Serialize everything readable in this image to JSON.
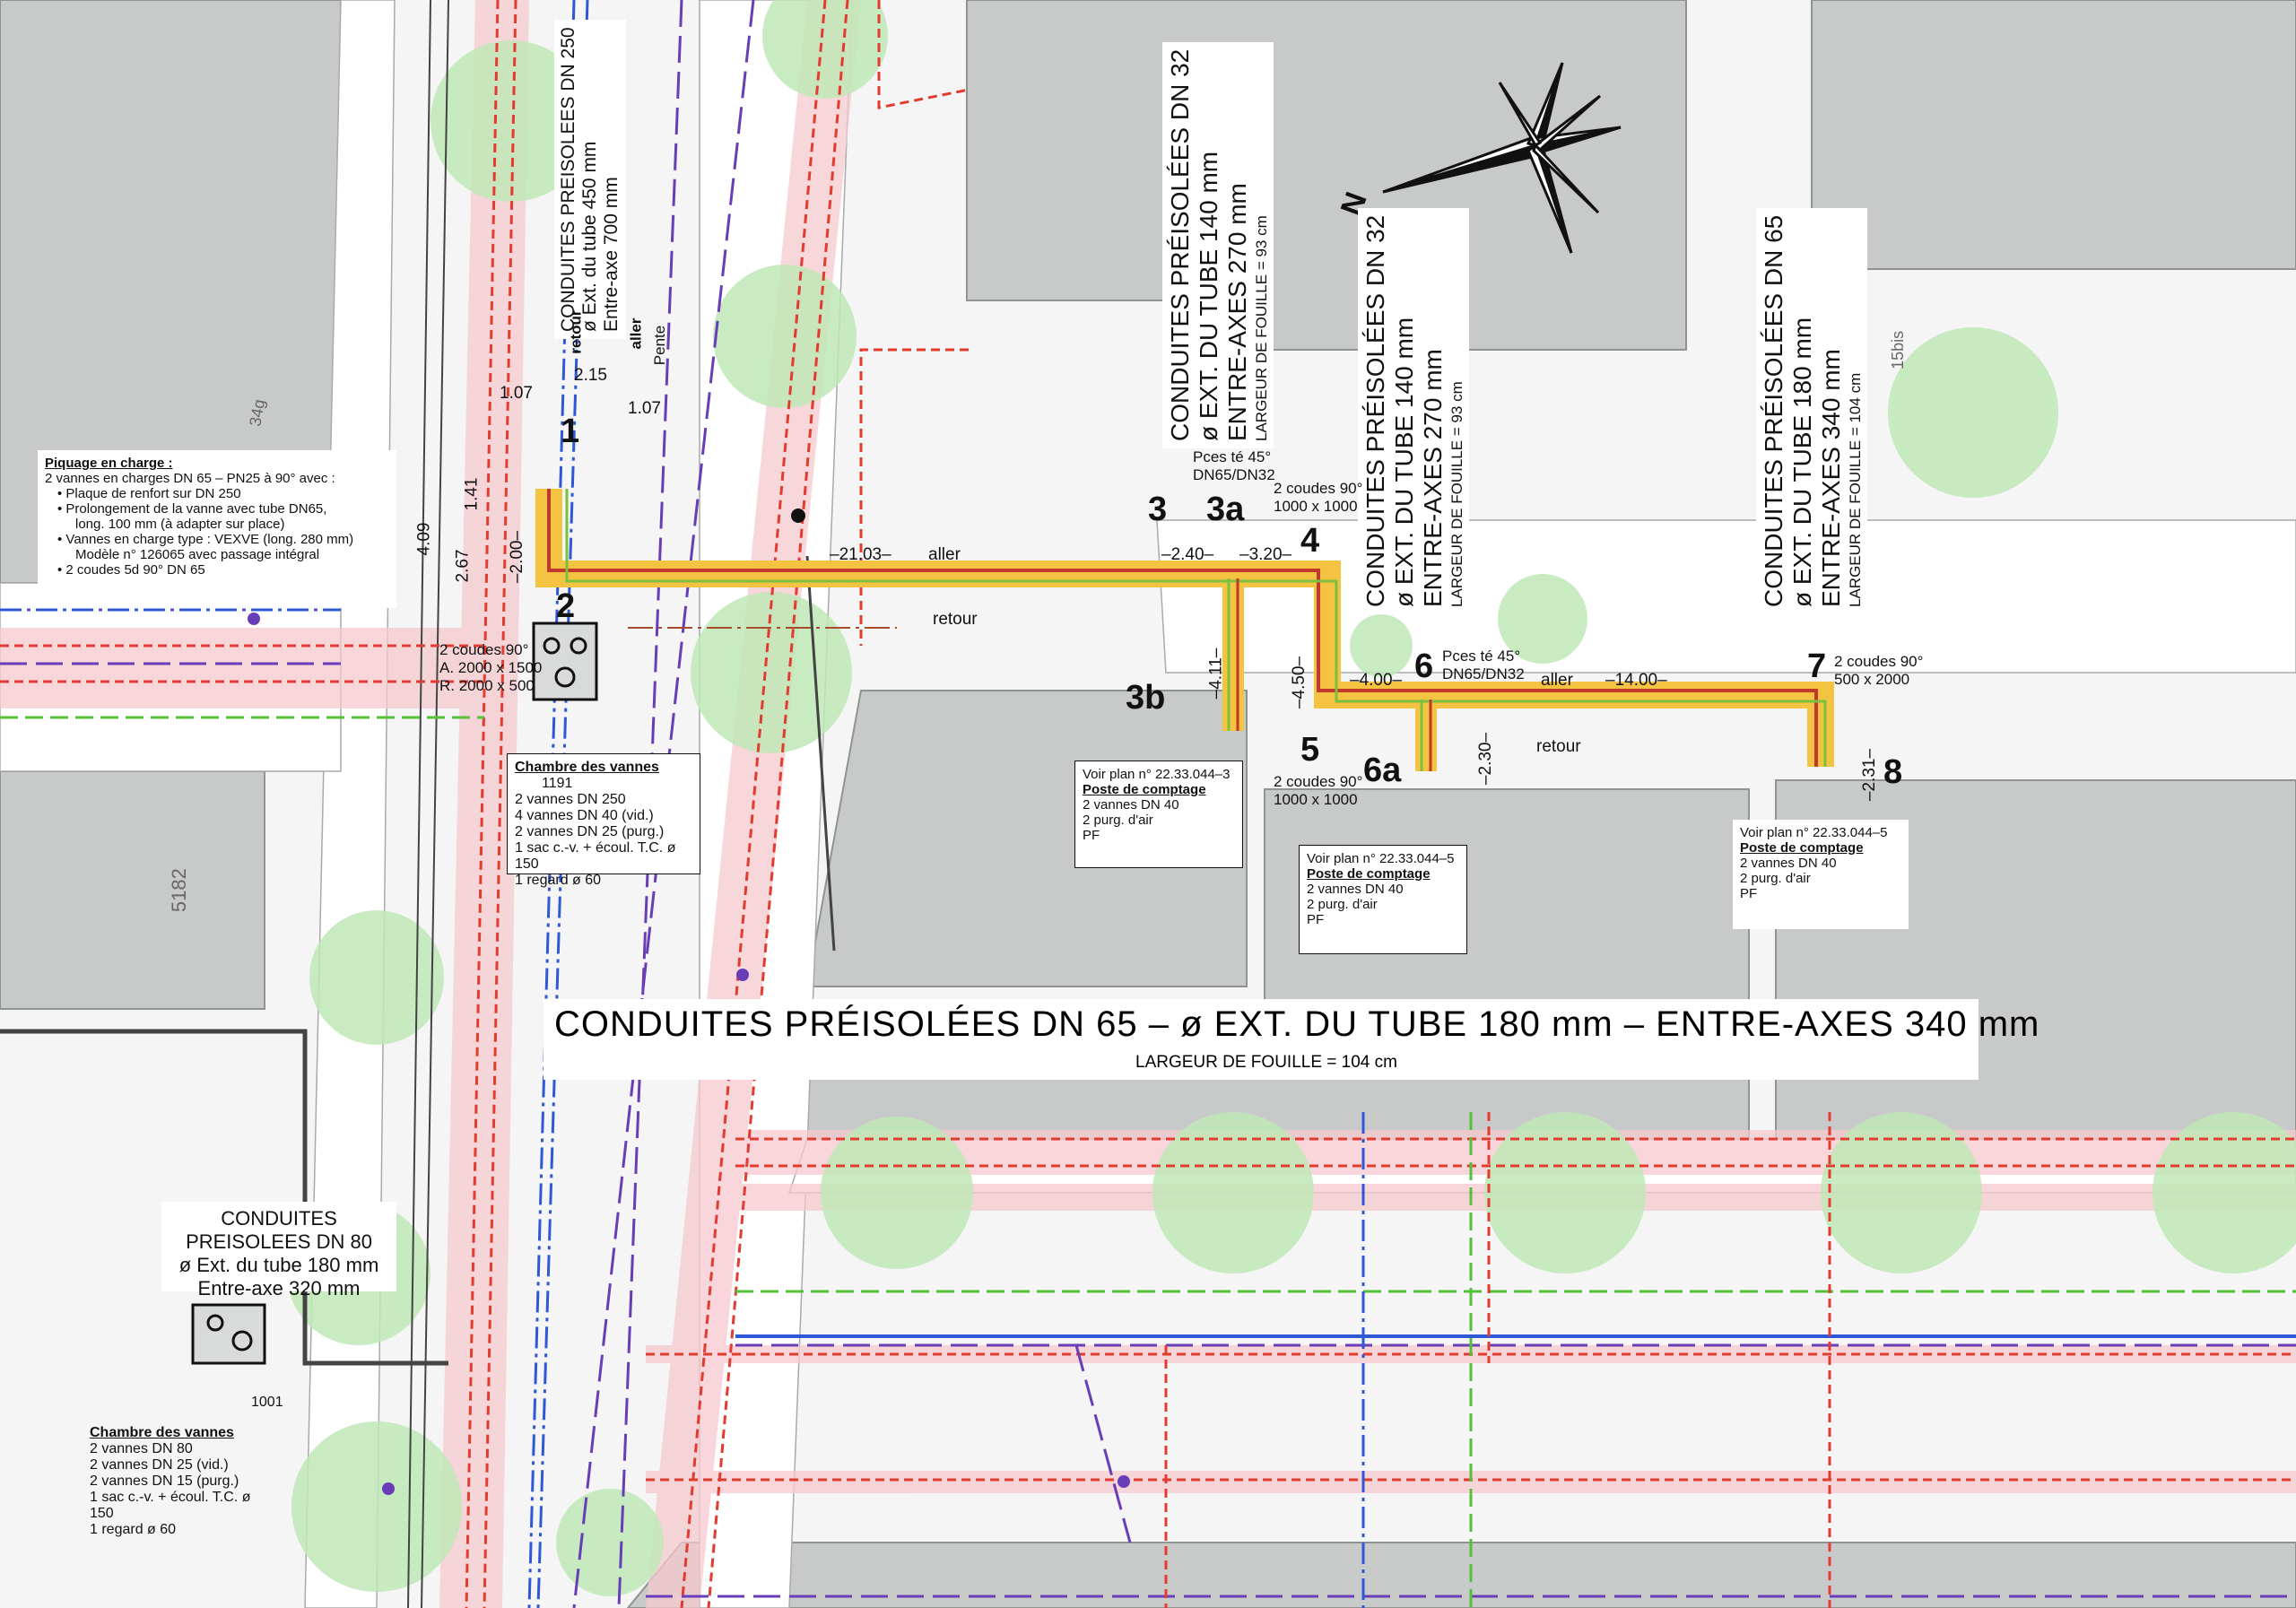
{
  "colors": {
    "building": "#c7cac8",
    "building_edge": "#8f9490",
    "tree": "#bfe7b6",
    "pipe_outer": "#f5c342",
    "pipe_red": "#c0392b",
    "pipe_green": "#7cc040",
    "gas_red": "#e23b2f",
    "water_blue": "#2f58d6",
    "telecom_purple": "#6a3db8",
    "green_line": "#56c03a",
    "pink_band": "#f6c9cf"
  },
  "icons": [
    "north-arrow-icon",
    "tree-icon",
    "valve-chamber-icon"
  ],
  "compass": {
    "letter": "N"
  },
  "street_numbers": {
    "b5182": "5182",
    "b34g": "34g",
    "b15bis": "15bis"
  },
  "pipe_labels": {
    "dn250": {
      "l1": "CONDUITES PREISOLEES DN 250",
      "l2": "ø Ext. du tube 450 mm",
      "l3": "Entre-axe 700 mm"
    },
    "dn32a": {
      "l1": "CONDUITES PRÉISOLÉES DN 32",
      "l2": "ø EXT. DU TUBE 140 mm",
      "l3": "ENTRE-AXES 270 mm",
      "l4": "LARGEUR DE FOUILLE = 93 cm"
    },
    "dn32b": {
      "l1": "CONDUITES PRÉISOLÉES DN 32",
      "l2": "ø EXT. DU TUBE 140 mm",
      "l3": "ENTRE-AXES 270 mm",
      "l4": "LARGEUR DE FOUILLE = 93 cm"
    },
    "dn65v": {
      "l1": "CONDUITES PRÉISOLÉES DN 65",
      "l2": "ø EXT. DU TUBE 180 mm",
      "l3": "ENTRE-AXES 340 mm",
      "l4": "LARGEUR DE FOUILLE = 104 cm"
    },
    "dn80": {
      "l1": "CONDUITES PREISOLEES DN 80",
      "l2": "ø Ext. du tube 180 mm",
      "l3": "Entre-axe 320 mm"
    },
    "dn65_banner": {
      "l1": "CONDUITES PRÉISOLÉES DN 65   –   ø EXT. DU TUBE 180 mm   –   ENTRE-AXES 340 mm",
      "l2": "LARGEUR DE FOUILLE = 104 cm"
    }
  },
  "flow_labels": {
    "retour_top": "retour",
    "aller_top": "aller",
    "pente": "Pente",
    "aller_1": "aller",
    "retour_1": "retour",
    "aller_2": "aller",
    "retour_2": "retour"
  },
  "points": [
    "1",
    "2",
    "3",
    "3a",
    "3b",
    "4",
    "5",
    "6",
    "6a",
    "7",
    "8"
  ],
  "dimensions": {
    "d107a": "1.07",
    "d215": "2.15",
    "d107b": "1.07",
    "d409": "4.09",
    "d141": "1.41",
    "d267": "2.67",
    "d200": "–2.00–",
    "d2103": "–21.03–",
    "d240": "–2.40–",
    "d320": "–3.20–",
    "d411": "–4.11–",
    "d450": "–4.50–",
    "d400": "–4.00–",
    "d1400": "–14.00–",
    "d230": "–2.30–",
    "d231": "–2.31–"
  },
  "annotations": {
    "p3a": {
      "l1": "Pces té 45°",
      "l2": "DN65/DN32"
    },
    "p4": {
      "l1": "2 coudes 90°",
      "l2": "1000 x 1000"
    },
    "p5": {
      "l1": "2 coudes 90°",
      "l2": "1000 x 1000"
    },
    "p6": {
      "l1": "Pces té 45°",
      "l2": "DN65/DN32"
    },
    "p7": {
      "l1": "2 coudes 90°",
      "l2": "500 x 2000"
    },
    "p2": {
      "l1": "2 coudes 90°",
      "l2": "A. 2000 x 1500",
      "l3": "R. 2000 x 500"
    }
  },
  "boxes": {
    "piquage": {
      "title": "Piquage en charge :",
      "line1": "2 vannes en charges DN 65 – PN25 à 90° avec :",
      "b1": "Plaque de renfort sur DN 250",
      "b2a": "Prolongement de la vanne avec tube DN65,",
      "b2b": "long. 100 mm (à adapter sur place)",
      "b3a": "Vannes en charge type : VEXVE (long. 280 mm)",
      "b3b": "Modèle n° 126065 avec passage intégral",
      "b4": "2 coudes 5d 90° DN 65"
    },
    "chambre1191": {
      "title": "Chambre des vannes",
      "id": "1191",
      "l1": "2 vannes DN 250",
      "l2": "4 vannes DN 40 (vid.)",
      "l3": "2 vannes DN 25 (purg.)",
      "l4": "1 sac c.-v. + écoul. T.C. ø 150",
      "l5": "1 regard ø 60"
    },
    "chambre1001": {
      "title": "Chambre des vannes",
      "id": "1001",
      "l1": "2 vannes DN 80",
      "l2": "2 vannes DN 25 (vid.)",
      "l3": "2 vannes DN 15 (purg.)",
      "l4": "1 sac c.-v. + écoul. T.C. ø 150",
      "l5": "1 regard ø 60"
    },
    "poste3": {
      "ref": "Voir plan n° 22.33.044–3",
      "title": "Poste de comptage",
      "l1": "2 vannes DN 40",
      "l2": "2 purg. d'air",
      "l3": "PF"
    },
    "poste5a": {
      "ref": "Voir plan n° 22.33.044–5",
      "title": "Poste de comptage",
      "l1": "2 vannes DN 40",
      "l2": "2 purg. d'air",
      "l3": "PF"
    },
    "poste5b": {
      "ref": "Voir plan n° 22.33.044–5",
      "title": "Poste de comptage",
      "l1": "2 vannes DN 40",
      "l2": "2 purg. d'air",
      "l3": "PF"
    }
  }
}
